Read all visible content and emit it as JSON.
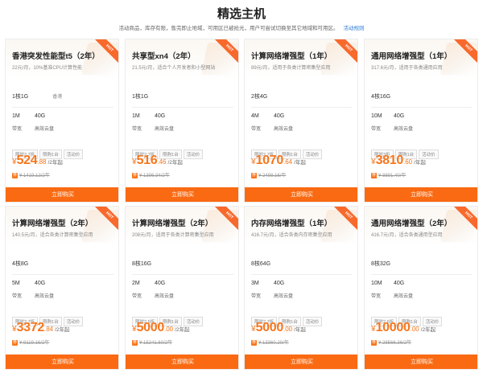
{
  "header": {
    "title": "精选主机",
    "notice": "活动商品，库存有限，售完即止地域，可用区已被抢光，用户可尝试切换至其它地域和可用区。",
    "rules_link": "活动规则"
  },
  "colors": {
    "accent": "#fa6a12",
    "price": "#f7761c",
    "link": "#2f7ed8"
  },
  "ribbon_text": "HOT",
  "buy_label": "立即购买",
  "products": [
    {
      "title": "香港突发性能型t5（2年）",
      "subtitle": "22元/月，10%基准CPU计算性能",
      "config": "1核1G",
      "region": "香港",
      "bandwidth": "1M",
      "bandwidth_label": "带宽",
      "disk": "40G",
      "disk_label": "高效云盘",
      "tags": [
        "限时2.7折",
        "限购1台",
        "活动价"
      ],
      "currency": "¥",
      "price_int": "524",
      "price_dec": ".88",
      "price_unit": "/2年起",
      "coupon_icon": "券",
      "original_price": "¥ 1419.12/2年"
    },
    {
      "title": "共享型xn4（2年）",
      "subtitle": "21.5元/月，适合个人开发者和小型网站",
      "config": "1核1G",
      "region": "",
      "bandwidth": "1M",
      "bandwidth_label": "带宽",
      "disk": "40G",
      "disk_label": "高效云盘",
      "tags": [
        "限时2.7折",
        "限购1台",
        "活动价"
      ],
      "currency": "¥",
      "price_int": "516",
      "price_dec": ".46",
      "price_unit": "/2年起",
      "coupon_icon": "券",
      "original_price": "¥ 1396.34/2年"
    },
    {
      "title": "计算网络增强型（1年）",
      "subtitle": "89元/月，适用于各类计算密集型应用",
      "config": "2核4G",
      "region": "",
      "bandwidth": "4M",
      "bandwidth_label": "带宽",
      "disk": "40G",
      "disk_label": "高效云盘",
      "tags": [
        "限时2.7折",
        "限购1台",
        "活动价"
      ],
      "currency": "¥",
      "price_int": "1070",
      "price_dec": ".64",
      "price_unit": "/年起",
      "coupon_icon": "券",
      "original_price": "¥ 2498.16/年"
    },
    {
      "title": "通用网络增强型（1年）",
      "subtitle": "317.6元/月，适用于各类通用应用",
      "config": "4核16G",
      "region": "",
      "bandwidth": "10M",
      "bandwidth_label": "带宽",
      "disk": "40G",
      "disk_label": "高效云盘",
      "tags": [
        "限时3折",
        "限购1台",
        "活动价"
      ],
      "currency": "¥",
      "price_int": "3810",
      "price_dec": ".60",
      "price_unit": "/年起",
      "coupon_icon": "券",
      "original_price": "¥ 8891.40/年"
    },
    {
      "title": "计算网络增强型（2年）",
      "subtitle": "140.5元/月，适合各类计算密集型应用",
      "config": "4核8G",
      "region": "",
      "bandwidth": "5M",
      "bandwidth_label": "带宽",
      "disk": "40G",
      "disk_label": "高效云盘",
      "tags": [
        "限时2.7折",
        "限购1台",
        "活动价"
      ],
      "currency": "¥",
      "price_int": "3372",
      "price_dec": ".84",
      "price_unit": "/2年起",
      "coupon_icon": "券",
      "original_price": "¥ 9119.16/2年"
    },
    {
      "title": "计算网络增强型（2年）",
      "subtitle": "208元/月，适用于各类计算密集型应用",
      "config": "8核16G",
      "region": "",
      "bandwidth": "2M",
      "bandwidth_label": "带宽",
      "disk": "40G",
      "disk_label": "高效云盘",
      "tags": [
        "限时2.5折",
        "限购1台",
        "活动价"
      ],
      "currency": "¥",
      "price_int": "5000",
      "price_dec": ".00",
      "price_unit": "/2年起",
      "coupon_icon": "券",
      "original_price": "¥ 15241.60/2年"
    },
    {
      "title": "内存网络增强型（1年）",
      "subtitle": "416.7元/月，适合各类内存密集型应用",
      "config": "8核64G",
      "region": "",
      "bandwidth": "3M",
      "bandwidth_label": "带宽",
      "disk": "40G",
      "disk_label": "高效云盘",
      "tags": [
        "限时2.7折",
        "限购1台",
        "活动价"
      ],
      "currency": "¥",
      "price_int": "5000",
      "price_dec": ".00",
      "price_unit": "/年起",
      "coupon_icon": "券",
      "original_price": "¥ 13360.20/年"
    },
    {
      "title": "通用网络增强型（2年）",
      "subtitle": "416.7元/月，适合各类通用型应用",
      "config": "8核32G",
      "region": "",
      "bandwidth": "10M",
      "bandwidth_label": "带宽",
      "disk": "40G",
      "disk_label": "高效云盘",
      "tags": [
        "限时2.6折",
        "限购1台",
        "活动价"
      ],
      "currency": "¥",
      "price_int": "10000",
      "price_dec": ".00",
      "price_unit": "/2年起",
      "coupon_icon": "券",
      "original_price": "¥ 28566.36/2年"
    }
  ]
}
